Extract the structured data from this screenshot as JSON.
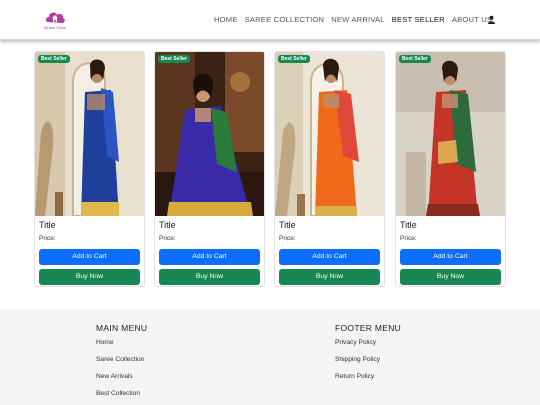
{
  "header": {
    "logo_text": "Saree Shop",
    "nav": [
      {
        "label": "HOME"
      },
      {
        "label": "SAREE COLLECTION"
      },
      {
        "label": "NEW ARRIVAL"
      },
      {
        "label": "BEST SELLER"
      },
      {
        "label": "ABOUT US"
      }
    ],
    "active_nav": "BEST SELLER",
    "user_icon": "user-icon"
  },
  "products": [
    {
      "badge": "Best Seller",
      "title": "Title",
      "price": "Price:",
      "cart_label": "Add to Cart",
      "buy_label": "Buy Now",
      "saree_color": "#1e3f9a"
    },
    {
      "badge": "Best Seller",
      "title": "Title",
      "price": "Price:",
      "cart_label": "Add to Cart",
      "buy_label": "Buy Now",
      "saree_color": "#3a2aa8"
    },
    {
      "badge": "Best Seller",
      "title": "Title",
      "price": "Price:",
      "cart_label": "Add to Cart",
      "buy_label": "Buy Now",
      "saree_color": "#f06a1c"
    },
    {
      "badge": "Best Seller",
      "title": "Title",
      "price": "Price:",
      "cart_label": "Add to Cart",
      "buy_label": "Buy Now",
      "saree_color": "#c43528"
    }
  ],
  "footer": {
    "main_menu": {
      "heading": "MAIN MENU",
      "links": [
        "Home",
        "Saree Collection",
        "New Arrivals",
        "Best Collection"
      ]
    },
    "footer_menu": {
      "heading": "FOOTER MENU",
      "links": [
        "Privacy Policy",
        "Shipping Policy",
        "Return Policy"
      ]
    }
  },
  "colors": {
    "primary": "#0d6efd",
    "success": "#198754",
    "footer_bg": "#f4f4f4"
  }
}
